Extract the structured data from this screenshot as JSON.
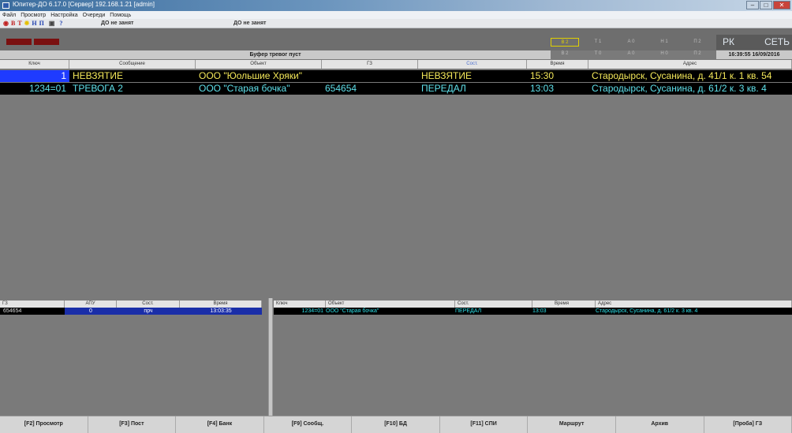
{
  "window": {
    "title": "Юпитер-ДО 6.17.0 [Сервер]   192.168.1.21 [admin]",
    "btn_min": "–",
    "btn_max": "□",
    "btn_close": "✕"
  },
  "menu": [
    "Файл",
    "Просмотр",
    "Настройка",
    "Очереди",
    "Помощь"
  ],
  "toolbar": {
    "items": [
      {
        "label": "В",
        "color": "#c02020"
      },
      {
        "label": "Т",
        "color": "#c02020"
      },
      {
        "label": "Н",
        "color": "#2040b0"
      },
      {
        "label": "П",
        "color": "#2040b0"
      }
    ],
    "status1": "ДО не занят",
    "status2": "ДО не занят"
  },
  "banner": "Буфер тревог пуст",
  "indicators": {
    "row1": [
      "В 2",
      "Т 1",
      "А 0",
      "Н 1",
      "П 2"
    ],
    "row2": [
      "В 2",
      "Т 0",
      "А 0",
      "Н 0",
      "П 2"
    ]
  },
  "rk": {
    "left": "РК",
    "right": "СЕТЬ"
  },
  "clock": "16:39:55 16/09/2016",
  "columns": [
    "Ключ",
    "Сообщение",
    "Объект",
    "ГЗ",
    "Сост.",
    "Время",
    "Адрес"
  ],
  "rows": [
    {
      "key": "1",
      "msg": "НЕВЗЯТИЕ",
      "obj": "ООО \"Юольшие Хряки\"",
      "gz": "",
      "state": "НЕВЗЯТИЕ",
      "time": "15:30",
      "addr": "Стародырск, Сусанина, д. 41/1 к. 1 кв. 54"
    },
    {
      "key": "1234=01",
      "msg": "ТРЕВОГА 2",
      "obj": "ООО \"Старая бочка\"",
      "gz": "654654",
      "state": "ПЕРЕДАЛ",
      "time": "13:03",
      "addr": "Стародырск, Сусанина, д. 61/2 к. 3 кв. 4"
    }
  ],
  "left_panel": {
    "columns": [
      "ГЗ",
      "АПУ",
      "Сост.",
      "Время"
    ],
    "row": {
      "gz": "654654",
      "apu": "0",
      "state": "прч",
      "time": "13:03:35"
    }
  },
  "right_panel": {
    "columns": [
      "Ключ",
      "Объект",
      "Сост.",
      "Время",
      "Адрес"
    ],
    "row": {
      "key": "1234=01",
      "obj": "ООО \"Старая бочка\"",
      "state": "ПЕРЕДАЛ",
      "time": "13:03",
      "addr": "Стародырск, Сусанина, д. 61/2 к. 3 кв. 4"
    }
  },
  "fkeys": [
    "[F2] Просмотр",
    "[F3] Пост",
    "[F4] Банк",
    "[F9] Сообщ.",
    "[F10] БД",
    "[F11] СПИ",
    "Маршрут",
    "Архив",
    "[Проба] ГЗ"
  ]
}
